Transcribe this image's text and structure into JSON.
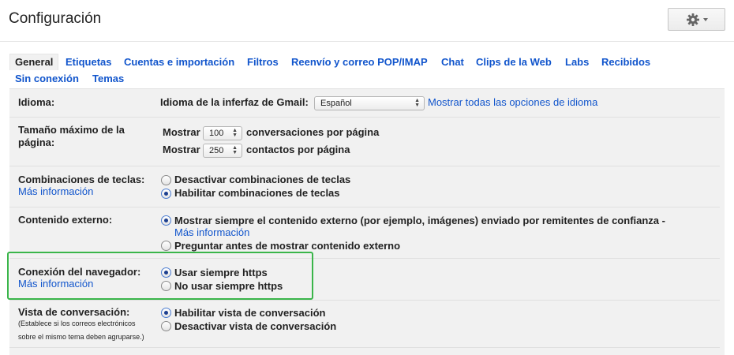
{
  "header": {
    "title": "Configuración",
    "settings_icon": "gear-icon"
  },
  "tabs": [
    {
      "label": "General",
      "active": true
    },
    {
      "label": "Etiquetas"
    },
    {
      "label": "Cuentas e importación"
    },
    {
      "label": "Filtros"
    },
    {
      "label": "Reenvío y correo POP/IMAP"
    },
    {
      "label": "Chat"
    },
    {
      "label": "Clips de la Web"
    },
    {
      "label": "Labs"
    },
    {
      "label": "Recibidos"
    },
    {
      "label": "Sin conexión"
    },
    {
      "label": "Temas"
    }
  ],
  "language": {
    "label": "Idioma:",
    "field_label": "Idioma de la inferfaz de Gmail:",
    "selected": "Español",
    "more_link": "Mostrar todas las opciones de idioma"
  },
  "page_size": {
    "label": "Tamaño máximo de la página:",
    "show_label": "Mostrar",
    "conversations_value": "100",
    "conversations_suffix": "conversaciones por página",
    "contacts_value": "250",
    "contacts_suffix": "contactos por página"
  },
  "shortcuts": {
    "label": "Combinaciones de teclas:",
    "more_link": "Más información",
    "options": [
      {
        "label": "Desactivar combinaciones de teclas",
        "checked": false
      },
      {
        "label": "Habilitar combinaciones de teclas",
        "checked": true
      }
    ]
  },
  "external_content": {
    "label": "Contenido externo:",
    "options": [
      {
        "label": "Mostrar siempre el contenido externo (por ejemplo, imágenes) enviado por remitentes de confianza -",
        "checked": true
      },
      {
        "label": "Preguntar antes de mostrar contenido externo",
        "checked": false
      }
    ],
    "more_link": "Más información"
  },
  "browser_connection": {
    "label": "Conexión del navegador:",
    "more_link": "Más información",
    "options": [
      {
        "label": "Usar siempre https",
        "checked": true
      },
      {
        "label": "No usar siempre https",
        "checked": false
      }
    ],
    "highlight_color": "#3ab54a"
  },
  "conversation_view": {
    "label": "Vista de conversación:",
    "note_line1": "(Establece si los correos electrónicos",
    "note_line2": "sobre el mismo tema deben agruparse.)",
    "options": [
      {
        "label": "Habilitar vista de conversación",
        "checked": true
      },
      {
        "label": "Desactivar vista de conversación",
        "checked": false
      }
    ]
  },
  "colors": {
    "link": "#1155cc",
    "panel": "#f1f1f1"
  }
}
